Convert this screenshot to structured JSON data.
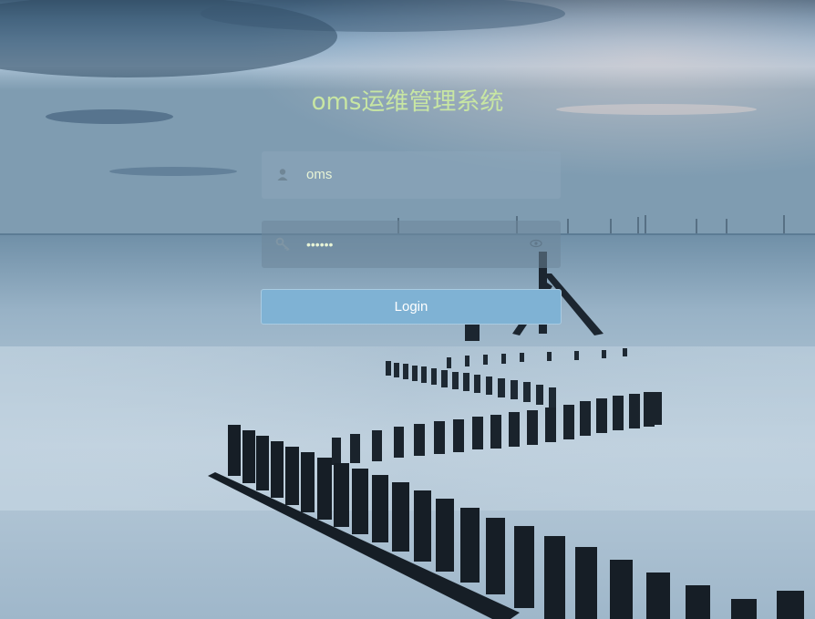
{
  "app": {
    "title": "oms运维管理系统"
  },
  "login_form": {
    "username_value": "oms",
    "password_mask": "••••••",
    "login_label": "Login"
  },
  "icons": {
    "user": "user-icon",
    "key": "key-icon",
    "eye": "eye-icon"
  },
  "colors": {
    "title": "#c8e6a3",
    "button_bg": "#7fb2d4",
    "field_text": "#e7f3d6"
  }
}
